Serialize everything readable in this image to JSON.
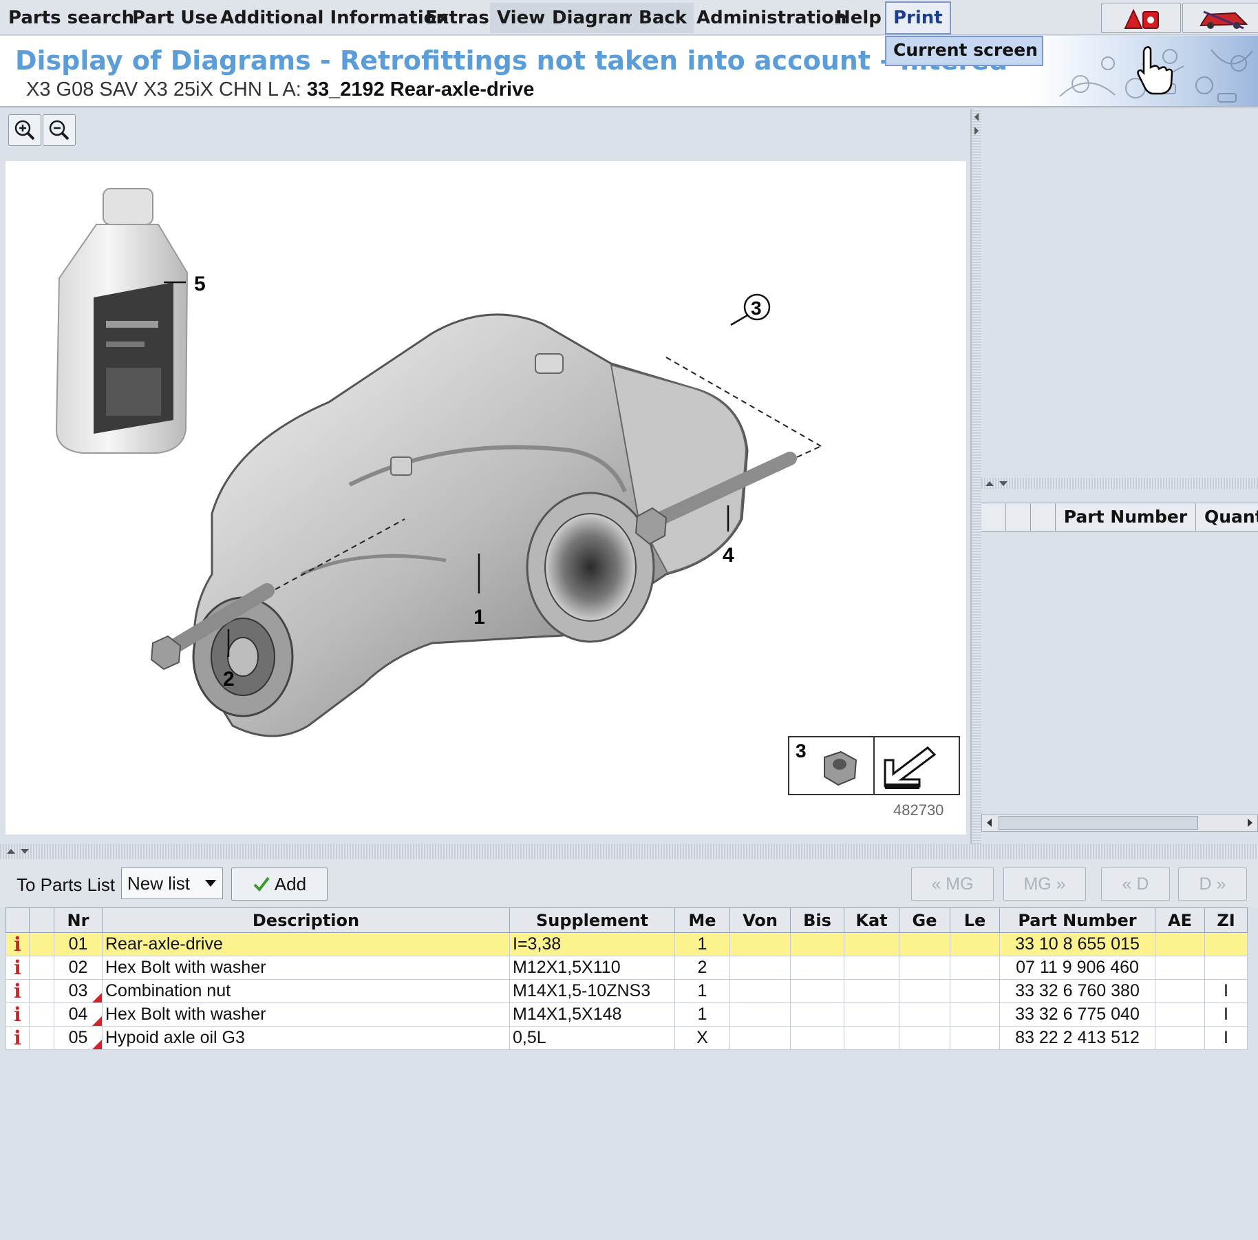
{
  "menu": {
    "items": [
      "Parts search",
      "Part Use",
      "Additional Information",
      "Extras",
      "View",
      "Diagram",
      "Back",
      "Administration",
      "Help",
      "Print"
    ],
    "dropdown_item": "Current screen"
  },
  "header": {
    "title": "Display of Diagrams - Retrofittings not taken into account - filtered",
    "vehicle": "X3 G08 SAV X3 25iX CHN  L A:",
    "group": "33_2192 Rear-axle-drive"
  },
  "diagram": {
    "image_number": "482730",
    "callouts": [
      "1",
      "2",
      "3",
      "4",
      "5"
    ],
    "inset_callout": "3"
  },
  "right_panel": {
    "columns": [
      "Part Number",
      "Quant"
    ]
  },
  "toolbar": {
    "to_parts_list_label": "To Parts List",
    "list_value": "New list",
    "add_label": "Add",
    "nav_prev_mg": "« MG",
    "nav_next_mg": "MG »",
    "nav_prev_d": "« D",
    "nav_next_d": "D »"
  },
  "parts_table": {
    "columns": [
      "",
      "",
      "Nr",
      "Description",
      "Supplement",
      "Me",
      "Von",
      "Bis",
      "Kat",
      "Ge",
      "Le",
      "Part Number",
      "AE",
      "ZI"
    ],
    "rows": [
      {
        "nr": "01",
        "description": "Rear-axle-drive",
        "supplement": "I=3,38",
        "me": "1",
        "part_number": "33 10 8 655 015",
        "zi": "",
        "flag": false,
        "selected": true
      },
      {
        "nr": "02",
        "description": "Hex Bolt with washer",
        "supplement": "M12X1,5X110",
        "me": "2",
        "part_number": "07 11 9 906 460",
        "zi": "",
        "flag": false,
        "selected": false
      },
      {
        "nr": "03",
        "description": "Combination nut",
        "supplement": "M14X1,5-10ZNS3",
        "me": "1",
        "part_number": "33 32 6 760 380",
        "zi": "I",
        "flag": true,
        "selected": false
      },
      {
        "nr": "04",
        "description": "Hex Bolt with washer",
        "supplement": "M14X1,5X148",
        "me": "1",
        "part_number": "33 32 6 775 040",
        "zi": "I",
        "flag": true,
        "selected": false
      },
      {
        "nr": "05",
        "description": "Hypoid axle oil G3",
        "supplement": "0,5L",
        "me": "X",
        "part_number": "83 22 2 413 512",
        "zi": "I",
        "flag": true,
        "selected": false
      }
    ]
  },
  "colors": {
    "title": "#5a9dd8",
    "selected_row": "#fcf38e",
    "info_icon": "#c8262b",
    "flag": "#d0232b"
  },
  "icons": [
    "zoom-in-icon",
    "zoom-out-icon",
    "alert-icon",
    "car-icon",
    "checkmark-icon",
    "dropdown-arrow-icon",
    "info-icon"
  ]
}
